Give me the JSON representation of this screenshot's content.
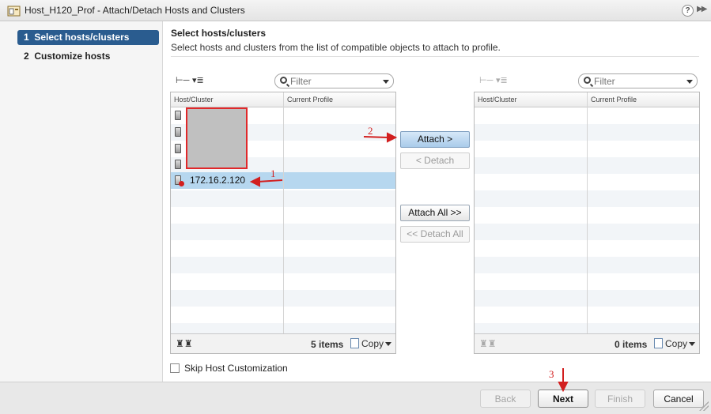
{
  "window": {
    "title": "Host_H120_Prof - Attach/Detach Hosts and Clusters",
    "help_label": "?",
    "expand_label": "▶▶"
  },
  "steps": [
    {
      "number": "1",
      "label": "Select hosts/clusters",
      "active": true
    },
    {
      "number": "2",
      "label": "Customize hosts",
      "active": false
    }
  ],
  "header": {
    "title": "Select hosts/clusters",
    "subtitle": "Select hosts and clusters from the list of compatible objects to attach to profile."
  },
  "left_grid": {
    "filter_placeholder": "Filter",
    "columns": [
      "Host/Cluster",
      "Current Profile"
    ],
    "rows": [
      {
        "name": "",
        "profile": ""
      },
      {
        "name": "",
        "profile": ""
      },
      {
        "name": "",
        "profile": ""
      },
      {
        "name": "",
        "profile": ""
      },
      {
        "name": "172.16.2.120",
        "profile": "",
        "selected": true
      }
    ],
    "count_label": "5 items",
    "copy_label": "Copy"
  },
  "right_grid": {
    "filter_placeholder": "Filter",
    "columns": [
      "Host/Cluster",
      "Current Profile"
    ],
    "rows": [],
    "count_label": "0 items",
    "copy_label": "Copy"
  },
  "actions": {
    "attach": "Attach >",
    "detach": "< Detach",
    "attach_all": "Attach All >>",
    "detach_all": "<< Detach All"
  },
  "skip_customization_label": "Skip Host Customization",
  "footer": {
    "back": "Back",
    "next": "Next",
    "finish": "Finish",
    "cancel": "Cancel"
  },
  "annotations": [
    "1",
    "2",
    "3"
  ],
  "colors": {
    "accent": "#2a5c8f",
    "selection": "#b6d7ef",
    "annotation": "#d21f1f"
  }
}
